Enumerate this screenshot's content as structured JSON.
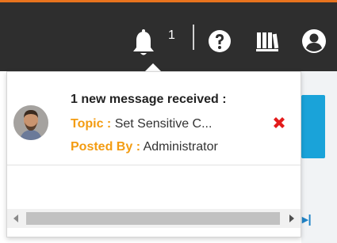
{
  "header": {
    "notification_count": "1",
    "icons": [
      "bell-icon",
      "help-icon",
      "library-icon",
      "user-icon"
    ],
    "accent_color": "#e8731e",
    "background_color": "#2e2e2e"
  },
  "notification": {
    "title": "1 new message received :",
    "topic_label": "Topic :",
    "topic_value": "Set Sensitive C...",
    "posted_label": "Posted By :",
    "posted_value": "Administrator",
    "label_color": "#f39c12",
    "dismiss_color": "#e31b1b"
  },
  "page": {
    "accent_color": "#1aa3d9",
    "nav_text": "▸|"
  }
}
